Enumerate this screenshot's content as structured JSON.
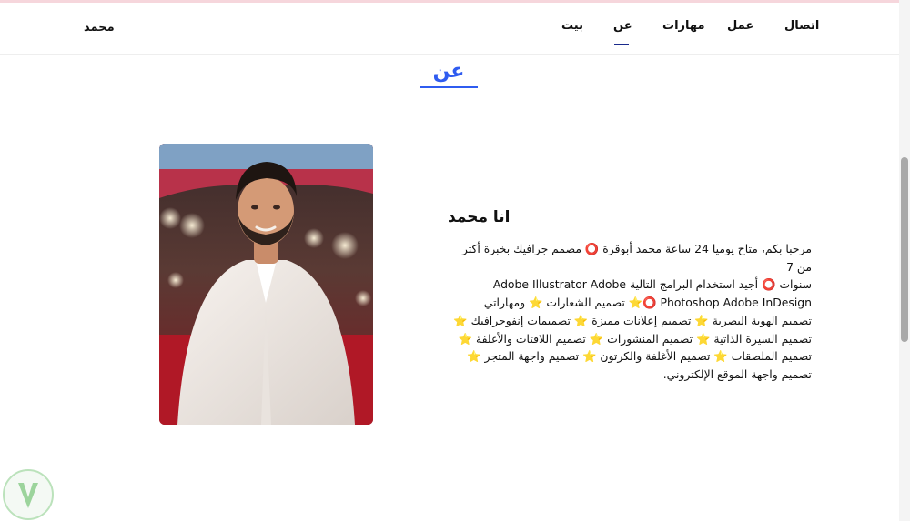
{
  "nav": {
    "brand": "محمد",
    "links": {
      "contact": "اتصال",
      "work": "عمل",
      "skills": "مهارات",
      "about": "عن",
      "home": "بيت"
    }
  },
  "about": {
    "section_title": "عن",
    "name": "انا محمد",
    "lines": [
      "مرحبا بكم، متاح يوميا 24 ساعة محمد أبوقرة ⭕ مصمم جرافيك بخبرة أكثر من 7",
      "سنوات ⭕ أجيد استخدام البرامج التالية Adobe Illustrator Adobe",
      "Photoshop Adobe InDesign ⭕⭐ تصميم الشعارات ⭐ ومهاراتي",
      "تصميم الهوية البصرية ⭐ تصميم إعلانات مميزة ⭐ تصميمات إنفوجرافيك ⭐",
      "تصميم السيرة الذاتية ⭐ تصميم المنشورات ⭐ تصميم اللافتات والأغلفة ⭐",
      "تصميم الملصقات ⭐ تصميم الأغلفة والكرتون ⭐ تصميم واجهة المتجر ⭐",
      "تصميم واجهة الموقع الإلكتروني."
    ]
  },
  "colors": {
    "accent": "#2f5cf0",
    "nav_underline": "#1a2a8c",
    "text": "#111111"
  },
  "icons": {
    "profile_photo": "profile-photo",
    "watermark": "watermark-logo"
  }
}
